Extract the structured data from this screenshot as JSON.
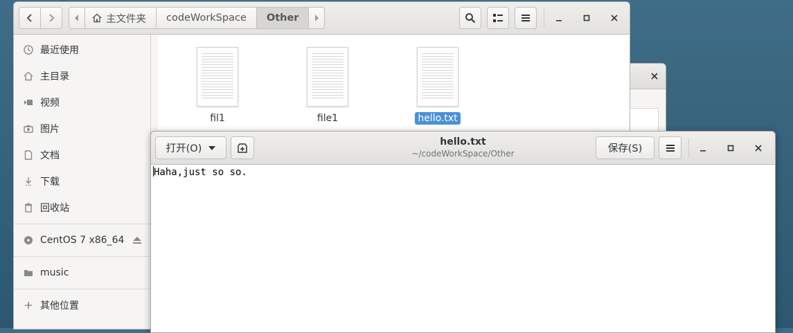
{
  "file_manager": {
    "nav": {
      "back_icon": "chevron-left-icon",
      "forward_icon": "chevron-right-icon"
    },
    "path": [
      {
        "label": "主文件夹",
        "icon": "home-icon"
      },
      {
        "label": "codeWorkSpace"
      },
      {
        "label": "Other",
        "active": true
      }
    ],
    "toolbar": {
      "search_icon": "search-icon",
      "view_icon": "list-view-icon",
      "menu_icon": "hamburger-icon"
    },
    "window": {
      "minimize": "–",
      "maximize": "□",
      "close": "×"
    },
    "sidebar": {
      "items": [
        {
          "label": "最近使用",
          "icon": "clock-icon"
        },
        {
          "label": "主目录",
          "icon": "home-icon"
        },
        {
          "label": "视频",
          "icon": "video-icon"
        },
        {
          "label": "图片",
          "icon": "camera-icon"
        },
        {
          "label": "文档",
          "icon": "document-icon"
        },
        {
          "label": "下载",
          "icon": "download-icon"
        },
        {
          "label": "回收站",
          "icon": "trash-icon"
        }
      ],
      "devices": [
        {
          "label": "CentOS 7 x86_64",
          "icon": "disc-icon",
          "action_icon": "eject-icon"
        }
      ],
      "bookmarks": [
        {
          "label": "music",
          "icon": "folder-icon"
        }
      ],
      "other": {
        "label": "其他位置",
        "icon": "plus-icon"
      }
    },
    "files": [
      {
        "name": "fil1",
        "selected": false
      },
      {
        "name": "file1",
        "selected": false
      },
      {
        "name": "hello.txt",
        "selected": true
      }
    ]
  },
  "editor": {
    "open_button": "打开(O)",
    "save_button": "保存(S)",
    "title": "hello.txt",
    "subtitle": "~/codeWorkSpace/Other",
    "content": "Haha,just so so.",
    "window": {
      "minimize": "–",
      "maximize": "□",
      "close": "×"
    }
  },
  "colors": {
    "selection": "#4a90d9",
    "desktop": "#2f5a73"
  }
}
